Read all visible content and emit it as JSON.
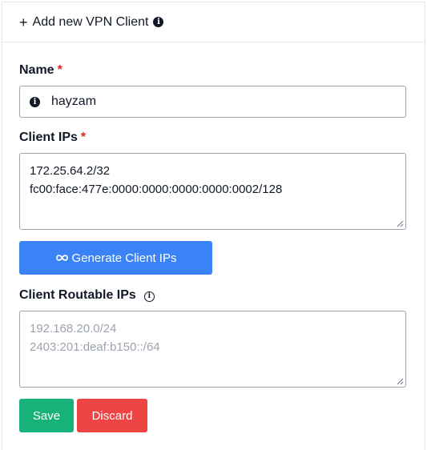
{
  "header": {
    "plus_glyph": "+",
    "title": "Add new VPN Client",
    "info_icon": "info-icon"
  },
  "form": {
    "name": {
      "label": "Name",
      "required_mark": "*",
      "value": "hayzam",
      "icon": "info-icon"
    },
    "client_ips": {
      "label": "Client IPs",
      "required_mark": "*",
      "lines": [
        "172.25.64.2/32",
        "fc00:face:477e:0000:0000:0000:0000:0002/128"
      ]
    },
    "generate_button": {
      "icon": "infinity-icon",
      "label": "Generate Client IPs"
    },
    "routable_ips": {
      "label": "Client Routable IPs",
      "info_icon": "info-outline-icon",
      "placeholder_lines": [
        "192.168.20.0/24",
        "2403:201:deaf:b150::/64"
      ]
    },
    "actions": {
      "save_label": "Save",
      "discard_label": "Discard"
    }
  },
  "colors": {
    "primary": "#3b82f6",
    "success": "#16b27a",
    "danger": "#ef4444",
    "required": "#dc2626"
  }
}
